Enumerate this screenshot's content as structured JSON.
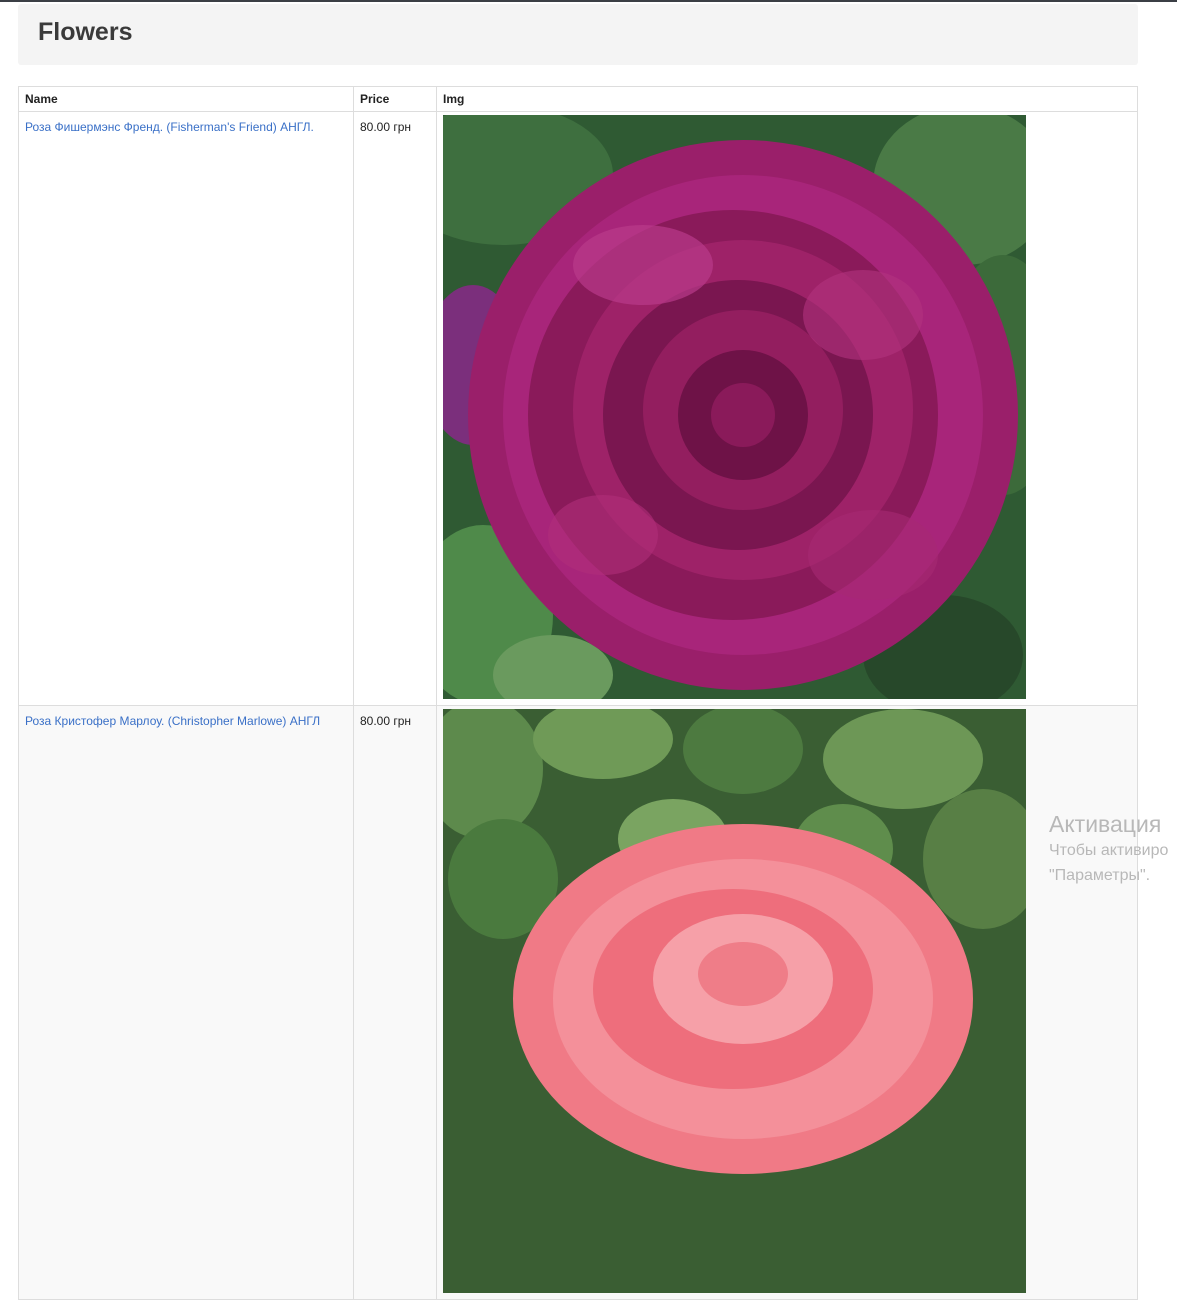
{
  "page": {
    "title": "Flowers"
  },
  "table": {
    "columns": [
      "Name",
      "Price",
      "Img"
    ],
    "rows": [
      {
        "name": "Роза Фишермэнс Френд. (Fisherman's Friend) АНГЛ.",
        "price": "80.00 грн",
        "image": "deep magenta rose photo"
      },
      {
        "name": "Роза Кристофер Марлоу. (Christopher Marlowe) АНГЛ",
        "price": "80.00 грн",
        "image": "pink rose photo"
      }
    ]
  },
  "watermark": {
    "title": "Активация",
    "line1": "Чтобы активиро",
    "line2": "\"Параметры\"."
  },
  "colors": {
    "link": "#3a70c7",
    "header_bg": "#f4f4f4",
    "rose1": "#8e1a5e",
    "rose2": "#f06b7a",
    "leaves": "#3d6b3a"
  }
}
